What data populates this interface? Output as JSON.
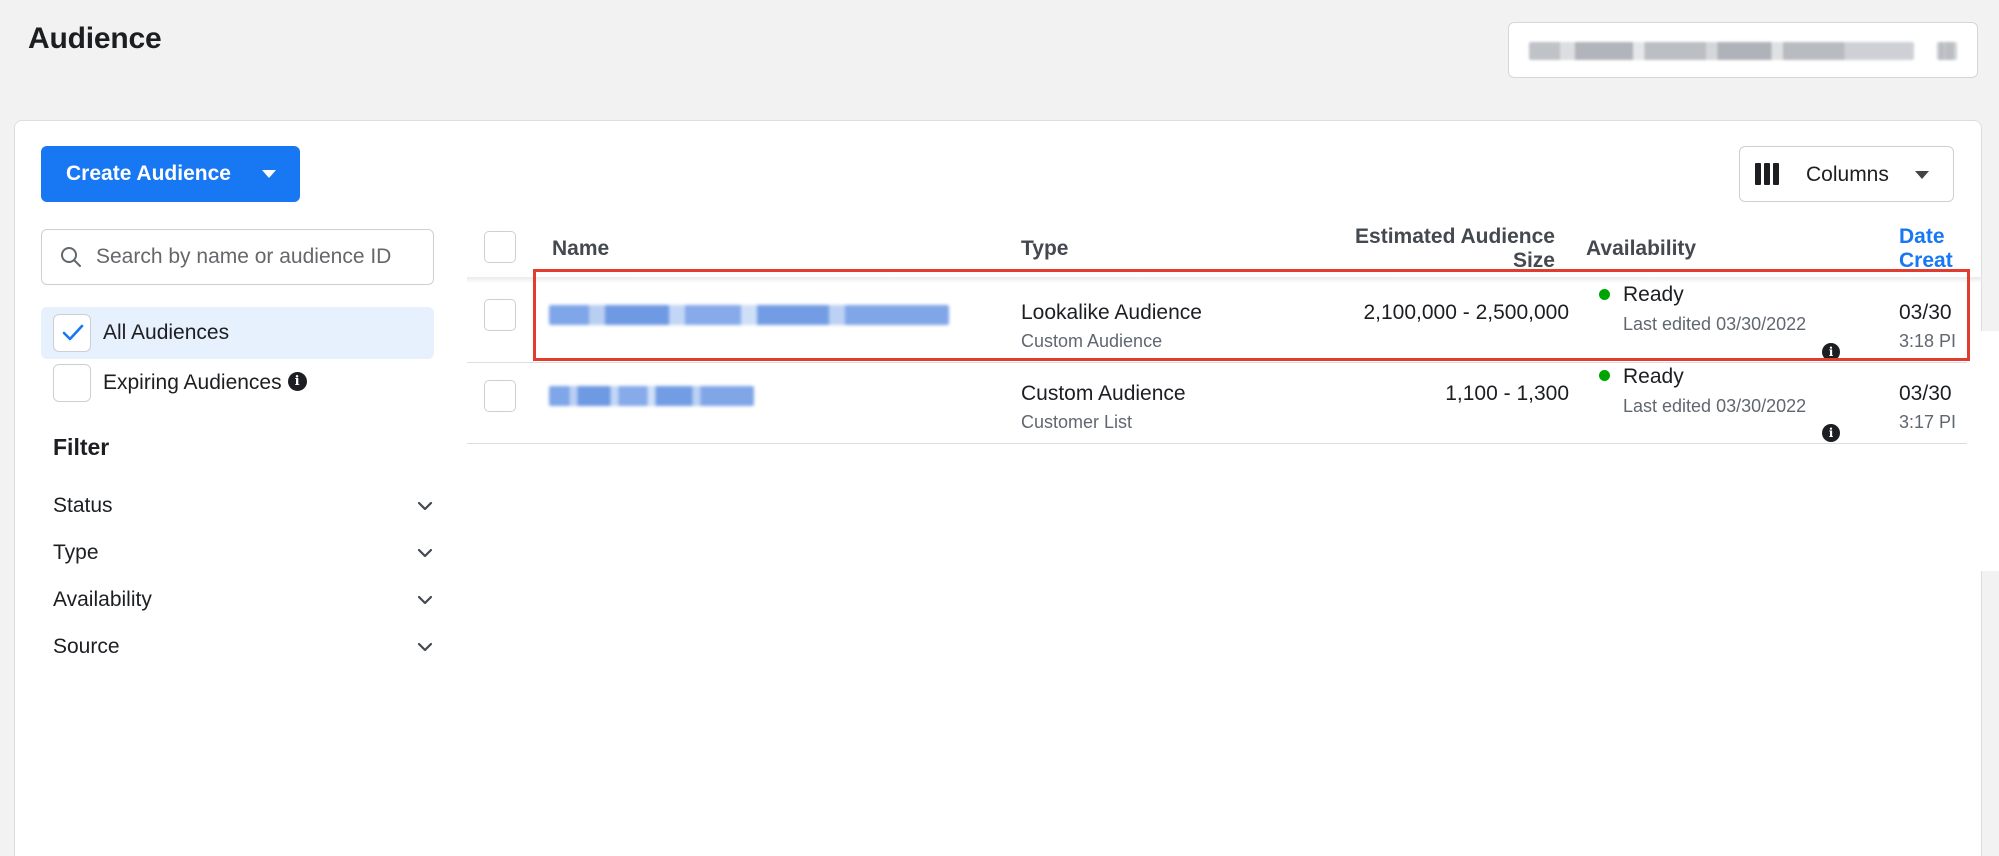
{
  "page": {
    "title": "Audience"
  },
  "toolbar": {
    "create_label": "Create Audience",
    "columns_label": "Columns"
  },
  "sidebar": {
    "search_placeholder": "Search by name or audience ID",
    "items": [
      {
        "label": "All Audiences",
        "checked": true
      },
      {
        "label": "Expiring Audiences",
        "checked": false
      }
    ],
    "filter_title": "Filter",
    "filters": [
      {
        "label": "Status"
      },
      {
        "label": "Type"
      },
      {
        "label": "Availability"
      },
      {
        "label": "Source"
      }
    ]
  },
  "table": {
    "headers": {
      "name": "Name",
      "type": "Type",
      "size_line1": "Estimated Audience",
      "size_line2": "Size",
      "availability": "Availability",
      "date_line1": "Date",
      "date_line2": "Creat"
    },
    "rows": [
      {
        "type": "Lookalike Audience",
        "subtype": "Custom Audience",
        "size": "2,100,000 - 2,500,000",
        "status": "Ready",
        "edited": "Last edited 03/30/2022",
        "date": "03/30",
        "time": "3:18 PI"
      },
      {
        "type": "Custom Audience",
        "subtype": "Customer List",
        "size": "1,100 - 1,300",
        "status": "Ready",
        "edited": "Last edited 03/30/2022",
        "date": "03/30",
        "time": "3:17 PI"
      }
    ]
  },
  "colors": {
    "accent": "#1877f2",
    "ready": "#00a400",
    "highlight": "#e23c2e"
  }
}
